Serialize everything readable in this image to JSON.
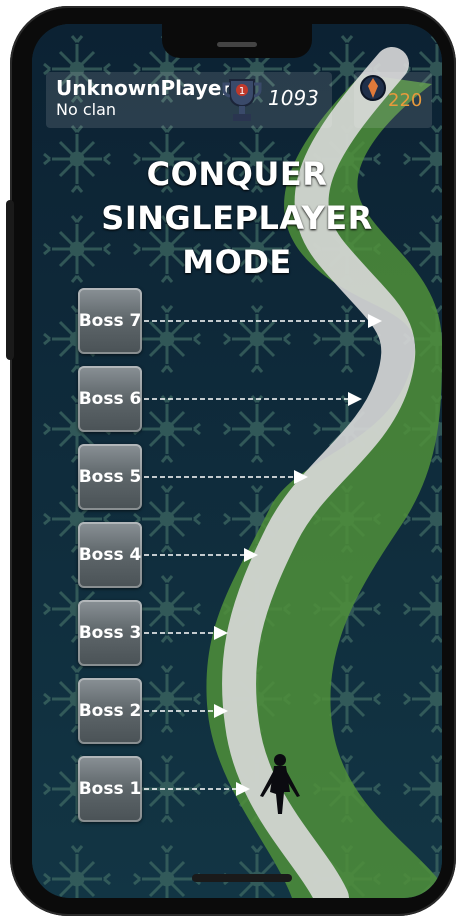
{
  "header": {
    "player_name": "UnknownPlayer",
    "clan": "No clan",
    "trophy_rank": "1",
    "trophy_count": "1093",
    "gem_count": "220"
  },
  "title_line1": "CONQUER SINGLEPLAYER",
  "title_line2": "MODE",
  "bosses": [
    {
      "label": "Boss 7"
    },
    {
      "label": "Boss 6"
    },
    {
      "label": "Boss 5"
    },
    {
      "label": "Boss 4"
    },
    {
      "label": "Boss 3"
    },
    {
      "label": "Boss 2"
    },
    {
      "label": "Boss 1"
    }
  ],
  "colors": {
    "background": "#0f2b3a",
    "path": "#d9d9d9",
    "grass": "#4f8f3a",
    "gem_text": "#e89a3c"
  },
  "icons": [
    "trophy-icon",
    "gem-icon",
    "ninja-character"
  ]
}
